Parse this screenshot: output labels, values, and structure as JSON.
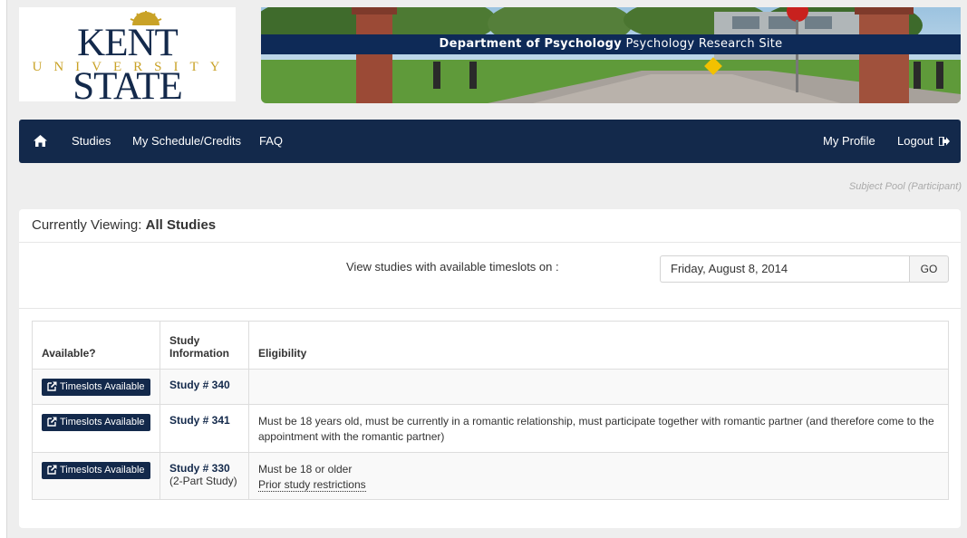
{
  "logo": {
    "line1": "KENT STATE",
    "line2": "UNIVERSITY"
  },
  "banner": {
    "dept": "Department of Psychology",
    "site": "Psychology Research Site"
  },
  "nav": {
    "home_icon": "home-icon",
    "studies": "Studies",
    "schedule": "My Schedule/Credits",
    "faq": "FAQ",
    "profile": "My Profile",
    "logout": "Logout",
    "logout_icon": "sign-out-icon"
  },
  "role_note": "Subject Pool (Participant)",
  "viewing": {
    "prefix": "Currently Viewing:",
    "value": "All Studies"
  },
  "date_filter": {
    "label": "View studies with available timeslots on :",
    "value": "Friday, August 8, 2014",
    "go": "GO"
  },
  "table": {
    "headers": {
      "available": "Available?",
      "info_line1": "Study",
      "info_line2": "Information",
      "eligibility": "Eligibility"
    },
    "rows": [
      {
        "button": "Timeslots Available",
        "study": "Study # 340",
        "note": "",
        "eligibility": "",
        "link": ""
      },
      {
        "button": "Timeslots Available",
        "study": "Study # 341",
        "note": "",
        "eligibility": "Must be 18 years old, must be currently in a romantic relationship, must participate together with romantic partner (and therefore come to the appointment with the romantic partner)",
        "link": ""
      },
      {
        "button": "Timeslots Available",
        "study": "Study # 330",
        "note": "(2-Part Study)",
        "eligibility": "Must be 18 or older",
        "link": "Prior study restrictions"
      }
    ]
  },
  "colors": {
    "navy": "#13294b",
    "gold": "#c9a227",
    "banner_strip": "#0e2a57"
  }
}
